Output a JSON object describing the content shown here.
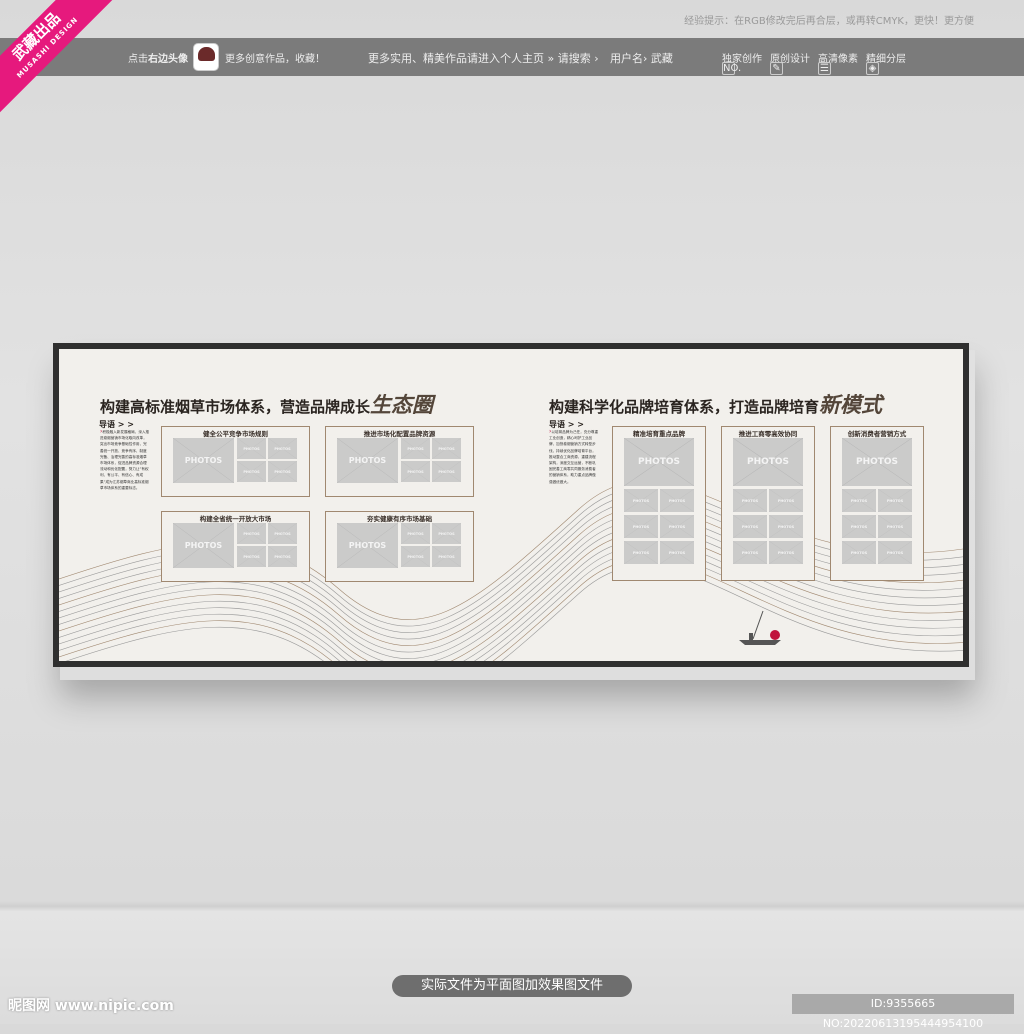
{
  "top_tip": "经验提示：在RGB修改完后再合层，或再转CMYK，更快！更方便",
  "ribbon": {
    "brand": "武藏出品",
    "sub": "MUSASHI DESIGN"
  },
  "banner": {
    "click_prefix": "点击",
    "click_bold": "右边头像",
    "more_works": "更多创意作品，收藏！",
    "search_text": "更多实用、精美作品请进入个人主页 » 请搜索 ›",
    "user_label": "用户名› 武藏",
    "badges": [
      {
        "icon": "no-icon",
        "glyph": "NO.",
        "label": "独家创作"
      },
      {
        "icon": "pen-icon",
        "glyph": "✎",
        "label": "原创设计"
      },
      {
        "icon": "list-icon",
        "glyph": "☰",
        "label": "高清像素"
      },
      {
        "icon": "layers-icon",
        "glyph": "◈",
        "label": "精细分层"
      }
    ]
  },
  "board": {
    "left": {
      "title": "构建高标准烟草市场体系，营造品牌成长",
      "title_em": "生态圈",
      "guide": "导语 > >",
      "intro": "积极融入新发展格局，深入推进卷烟营销市场化取向改革，突出市场竞争基础性作用，完善统一开放、竞争有序、制度完备、治理完善的高标准烟草市场体系，促进品牌资源合理流动和优化配置，努力让“有权利、有公平、有信心、有成果”成为江苏烟草商业高标准烟草市场体系的重要标志。",
      "panels": [
        "健全公平竞争市场规则",
        "推进市场化配置品牌资源",
        "构建全省统一开放大市场",
        "夯实健康有序市场基础"
      ]
    },
    "right": {
      "title": "构建科学化品牌培育体系，打造品牌培育",
      "title_em": "新模式",
      "guide": "导语 > >",
      "intro": "以培育品牌为己任，充分尊重工业创造，精心呵护工业品牌，加快卷烟营销方式转型步伐，持续优化品牌培育平台，推动整合工商资源，重建流程架构，深度交互运营，不断巩固完善工商零共同服务消费者的营销体系，助力重点品牌做强做优做大。",
      "panels": [
        "精准培育重点品牌",
        "推进工商零高效协同",
        "创新消费者营销方式"
      ]
    },
    "photo_label": "PHOTOS"
  },
  "footer": {
    "pill": "实际文件为平面图加效果图文件",
    "id": "ID:9355665 NO:20220613195444954100",
    "logo": "昵图网 www.nipic.com"
  },
  "colors": {
    "accent": "#e6197d",
    "frame": "#2f2f2f",
    "panel_border": "#a08870",
    "title_em": "#54463a"
  }
}
